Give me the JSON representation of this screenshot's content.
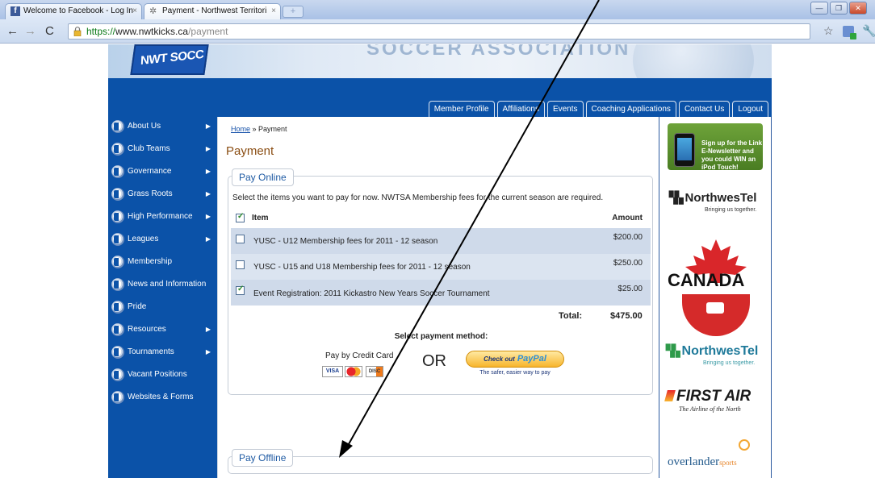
{
  "browser": {
    "tabs": [
      {
        "label": "Welcome to Facebook - Log In",
        "close": "×"
      },
      {
        "label": "Payment - Northwest Territori",
        "close": "×"
      }
    ],
    "url_scheme": "https://",
    "url_host": "www.nwtkicks.ca",
    "url_path": "/payment"
  },
  "site": {
    "logo_text": "NWT SOCC",
    "banner_text": "SOCCER ASSOCIATION",
    "top_nav": [
      "Member Profile",
      "Affiliations",
      "Events",
      "Coaching Applications",
      "Contact Us",
      "Logout"
    ],
    "left_nav": [
      {
        "label": "About Us",
        "submenu": true
      },
      {
        "label": "Club Teams",
        "submenu": true
      },
      {
        "label": "Governance",
        "submenu": true
      },
      {
        "label": "Grass Roots",
        "submenu": true
      },
      {
        "label": "High Performance",
        "submenu": true
      },
      {
        "label": "Leagues",
        "submenu": true
      },
      {
        "label": "Membership",
        "submenu": false
      },
      {
        "label": "News and Information",
        "submenu": false
      },
      {
        "label": "Pride",
        "submenu": false
      },
      {
        "label": "Resources",
        "submenu": true
      },
      {
        "label": "Tournaments",
        "submenu": true
      },
      {
        "label": "Vacant Positions",
        "submenu": false
      },
      {
        "label": "Websites & Forms",
        "submenu": false
      }
    ]
  },
  "breadcrumb": {
    "home": "Home",
    "sep": " » ",
    "current": "Payment"
  },
  "page_title": "Payment",
  "pay_online": {
    "legend": "Pay Online",
    "instructions": "Select the items you want to pay for now. NWTSA Membership fees for the current season are required.",
    "header_item": "Item",
    "header_amount": "Amount",
    "rows": [
      {
        "item": "YUSC - U12 Membership fees for 2011 - 12 season",
        "amount": "$200.00",
        "checked": false
      },
      {
        "item": "YUSC - U15 and U18 Membership fees for 2011 - 12 season",
        "amount": "$250.00",
        "checked": false
      },
      {
        "item": "Event Registration: 2011 Kickastro New Years Soccer Tournament",
        "amount": "$25.00",
        "checked": true
      }
    ],
    "total_label": "Total:",
    "total_value": "$475.00",
    "select_method": "Select payment method:",
    "credit_card_label": "Pay by Credit Card",
    "cards": [
      "VISA",
      "MC",
      "DISC"
    ],
    "or_text": "OR",
    "paypal_line1": "Check out",
    "paypal_line2": "PayPal",
    "paypal_sub": "The safer, easier way to pay"
  },
  "pay_offline": {
    "legend": "Pay Offline"
  },
  "sidebar_ads": {
    "ipod_text": "Sign up for the Link E-Newsletter and you could WIN an iPod Touch!",
    "nwtel_name": "NorthwesTel",
    "nwtel_tag": "Bringing us together.",
    "canada": "CANADA",
    "firstair": "FIRST AIR",
    "firstair_tag": "The Airline of the North",
    "overlander": "overlander",
    "overlander_sports": "sports"
  },
  "colors": {
    "brand_blue": "#0b52a8",
    "title_brown": "#8a4d12",
    "row_band": "#cfdaea"
  }
}
